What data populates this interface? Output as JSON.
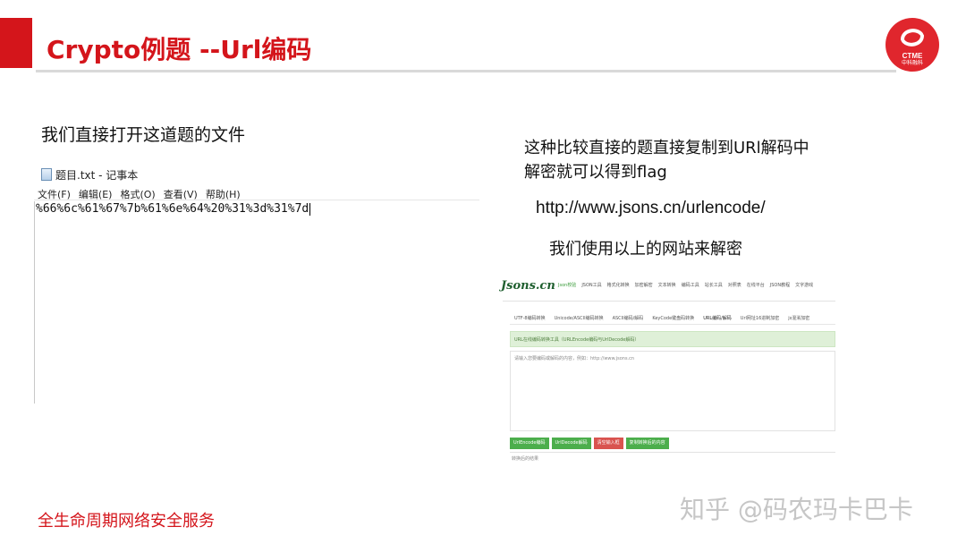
{
  "colors": {
    "accent_red": "#d4151b",
    "site_green": "#4cae4c",
    "site_red": "#d9534f"
  },
  "slide": {
    "title": "Crypto例题 --Url编码",
    "footer": "全生命周期网络安全服务"
  },
  "logo": {
    "name": "CTME",
    "sub": "中科融科"
  },
  "left": {
    "intro": "我们直接打开这道题的文件",
    "notepad": {
      "title": "题目.txt - 记事本",
      "menu": [
        "文件(F)",
        "编辑(E)",
        "格式(O)",
        "查看(V)",
        "帮助(H)"
      ],
      "content": "%66%6c%61%67%7b%61%6e%64%20%31%3d%31%7d"
    }
  },
  "right": {
    "desc_line1": "这种比较直接的题直接复制到URl解码中",
    "desc_line2": "解密就可以得到flag",
    "url": "http://www.jsons.cn/urlencode/",
    "usage": "我们使用以上的网站来解密"
  },
  "site": {
    "logo": "Jsons.cn",
    "nav": [
      "Json校验",
      "JSON工具",
      "格式化转换",
      "加密解密",
      "文本转换",
      "编码工具",
      "站长工具",
      "对照表",
      "在线平台",
      "JSON教程",
      "文字游戏"
    ],
    "tabs": [
      "UTF-8编码转换",
      "Unicode/ASCII编码转换",
      "ASCII编码/解码",
      "KeyCode键盘码转换",
      "URL编码/解码",
      "Url网址16进制加密",
      "js混淆加密"
    ],
    "active_tab": "URL编码/解码",
    "banner": "URL在线编码转换工具（URLEncode编码与UrlDecode解码）",
    "input_placeholder": "请输入您要编码或解码的内容，例如：http://www.jsons.cn",
    "buttons": [
      "UrlEncode编码",
      "UrlDecode解码",
      "清空输入框",
      "复制转换后的内容"
    ],
    "output_label": "转换后的结果"
  },
  "watermark": "知乎 @码农玛卡巴卡"
}
